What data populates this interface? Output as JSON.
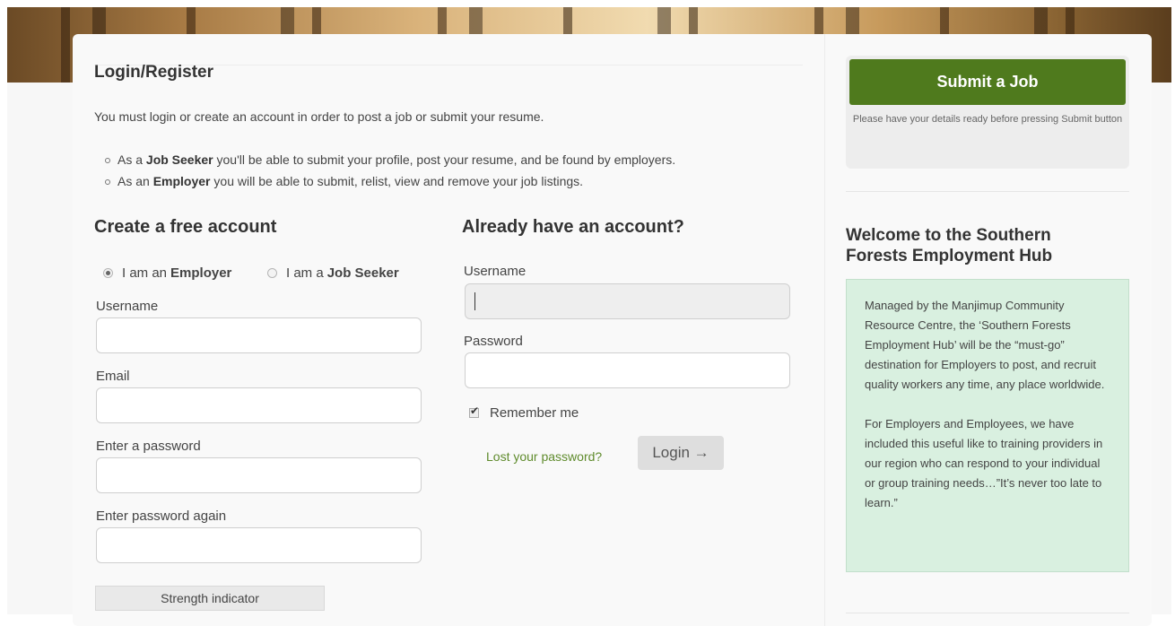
{
  "main": {
    "page_title": "Login/Register",
    "intro": "You must login or create an account in order to post a job or submit your resume.",
    "roles": [
      {
        "prefix": "As a ",
        "bold": "Job Seeker",
        "suffix": " you'll be able to submit your profile, post your resume, and be found by employers."
      },
      {
        "prefix": "As an ",
        "bold": "Employer",
        "suffix": " you will be able to submit, relist, view and remove your job listings."
      }
    ],
    "register": {
      "heading": "Create a free account",
      "radio_employer_prefix": "I am an",
      "radio_employer_bold": "Employer",
      "radio_seeker_prefix": "I am a",
      "radio_seeker_bold": "Job Seeker",
      "selected": "Employer",
      "username_label": "Username",
      "email_label": "Email",
      "password_label": "Enter a password",
      "password_again_label": "Enter password again",
      "strength_label": "Strength indicator"
    },
    "login": {
      "heading": "Already have an account?",
      "username_label": "Username",
      "password_label": "Password",
      "remember_label": "Remember me",
      "remember_checked": true,
      "lost_password": "Lost your password?",
      "login_button": "Login →"
    }
  },
  "sidebar": {
    "submit_button": "Submit a Job",
    "submit_note": "Please have your details ready before pressing Submit button",
    "submit_color": "#4f7a1d",
    "welcome_title": "Welcome to the Southern Forests Employment Hub",
    "welcome_paragraphs": [
      "Managed by the Manjimup Community Resource Centre, the ‘Southern Forests Employment Hub’ will be the “must-go” destination for Employers to post, and recruit quality workers any time, any place worldwide.",
      "For Employers and Employees, we have included this useful like to training providers in our region who can respond to your individual or group training needs…”It’s never too late to learn.”"
    ],
    "welcome_bg": "#d9f0e0"
  }
}
